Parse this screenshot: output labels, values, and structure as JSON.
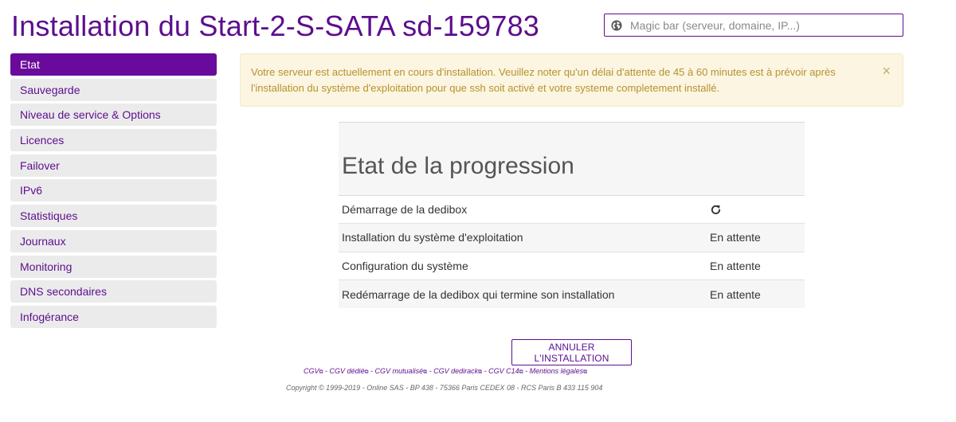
{
  "header": {
    "title": "Installation du Start-2-S-SATA sd-159783",
    "magic_bar_placeholder": "Magic bar (serveur, domaine, IP...)",
    "magic_bar_icon": "globe-icon"
  },
  "sidebar": {
    "items": [
      {
        "label": "Etat",
        "active": true
      },
      {
        "label": "Sauvegarde"
      },
      {
        "label": "Niveau de service & Options"
      },
      {
        "label": "Licences"
      },
      {
        "label": "Failover"
      },
      {
        "label": "IPv6"
      },
      {
        "label": "Statistiques"
      },
      {
        "label": "Journaux"
      },
      {
        "label": "Monitoring"
      },
      {
        "label": "DNS secondaires"
      },
      {
        "label": "Infogérance"
      }
    ]
  },
  "alert": {
    "text": "Votre serveur est actuellement en cours d'installation. Veuillez noter qu'un délai d'attente de 45 à 60 minutes est à prévoir après l'installation du système d'exploitation pour que ssh soit activé et votre systeme completement installé.",
    "close_label": "×"
  },
  "progress": {
    "title": "Etat de la progression",
    "steps": [
      {
        "label": "Démarrage de la dedibox",
        "status": "",
        "status_icon": "refresh-icon"
      },
      {
        "label": "Installation du système d'exploitation",
        "status": "En attente"
      },
      {
        "label": "Configuration du système",
        "status": "En attente"
      },
      {
        "label": "Redémarrage de la dedibox qui termine son installation",
        "status": "En attente"
      }
    ]
  },
  "actions": {
    "cancel_label": "ANNULER L'INSTALLATION"
  },
  "footer": {
    "links": [
      "CGV",
      "CGV dédié",
      "CGV mutualisé",
      "CGV dedirack",
      "CGV C14",
      "Mentions légales"
    ],
    "separator": " - ",
    "external_mark": "⧉",
    "copyright": "Copyright © 1999-2019 - Online SAS - BP 438 - 75366 Paris CEDEX 08 - RCS Paris B 433 115 904"
  },
  "colors": {
    "brand": "#5c0e8e",
    "active_nav": "#6a0a9c",
    "alert_bg": "#fbf5e1",
    "alert_text": "#b6932f"
  }
}
